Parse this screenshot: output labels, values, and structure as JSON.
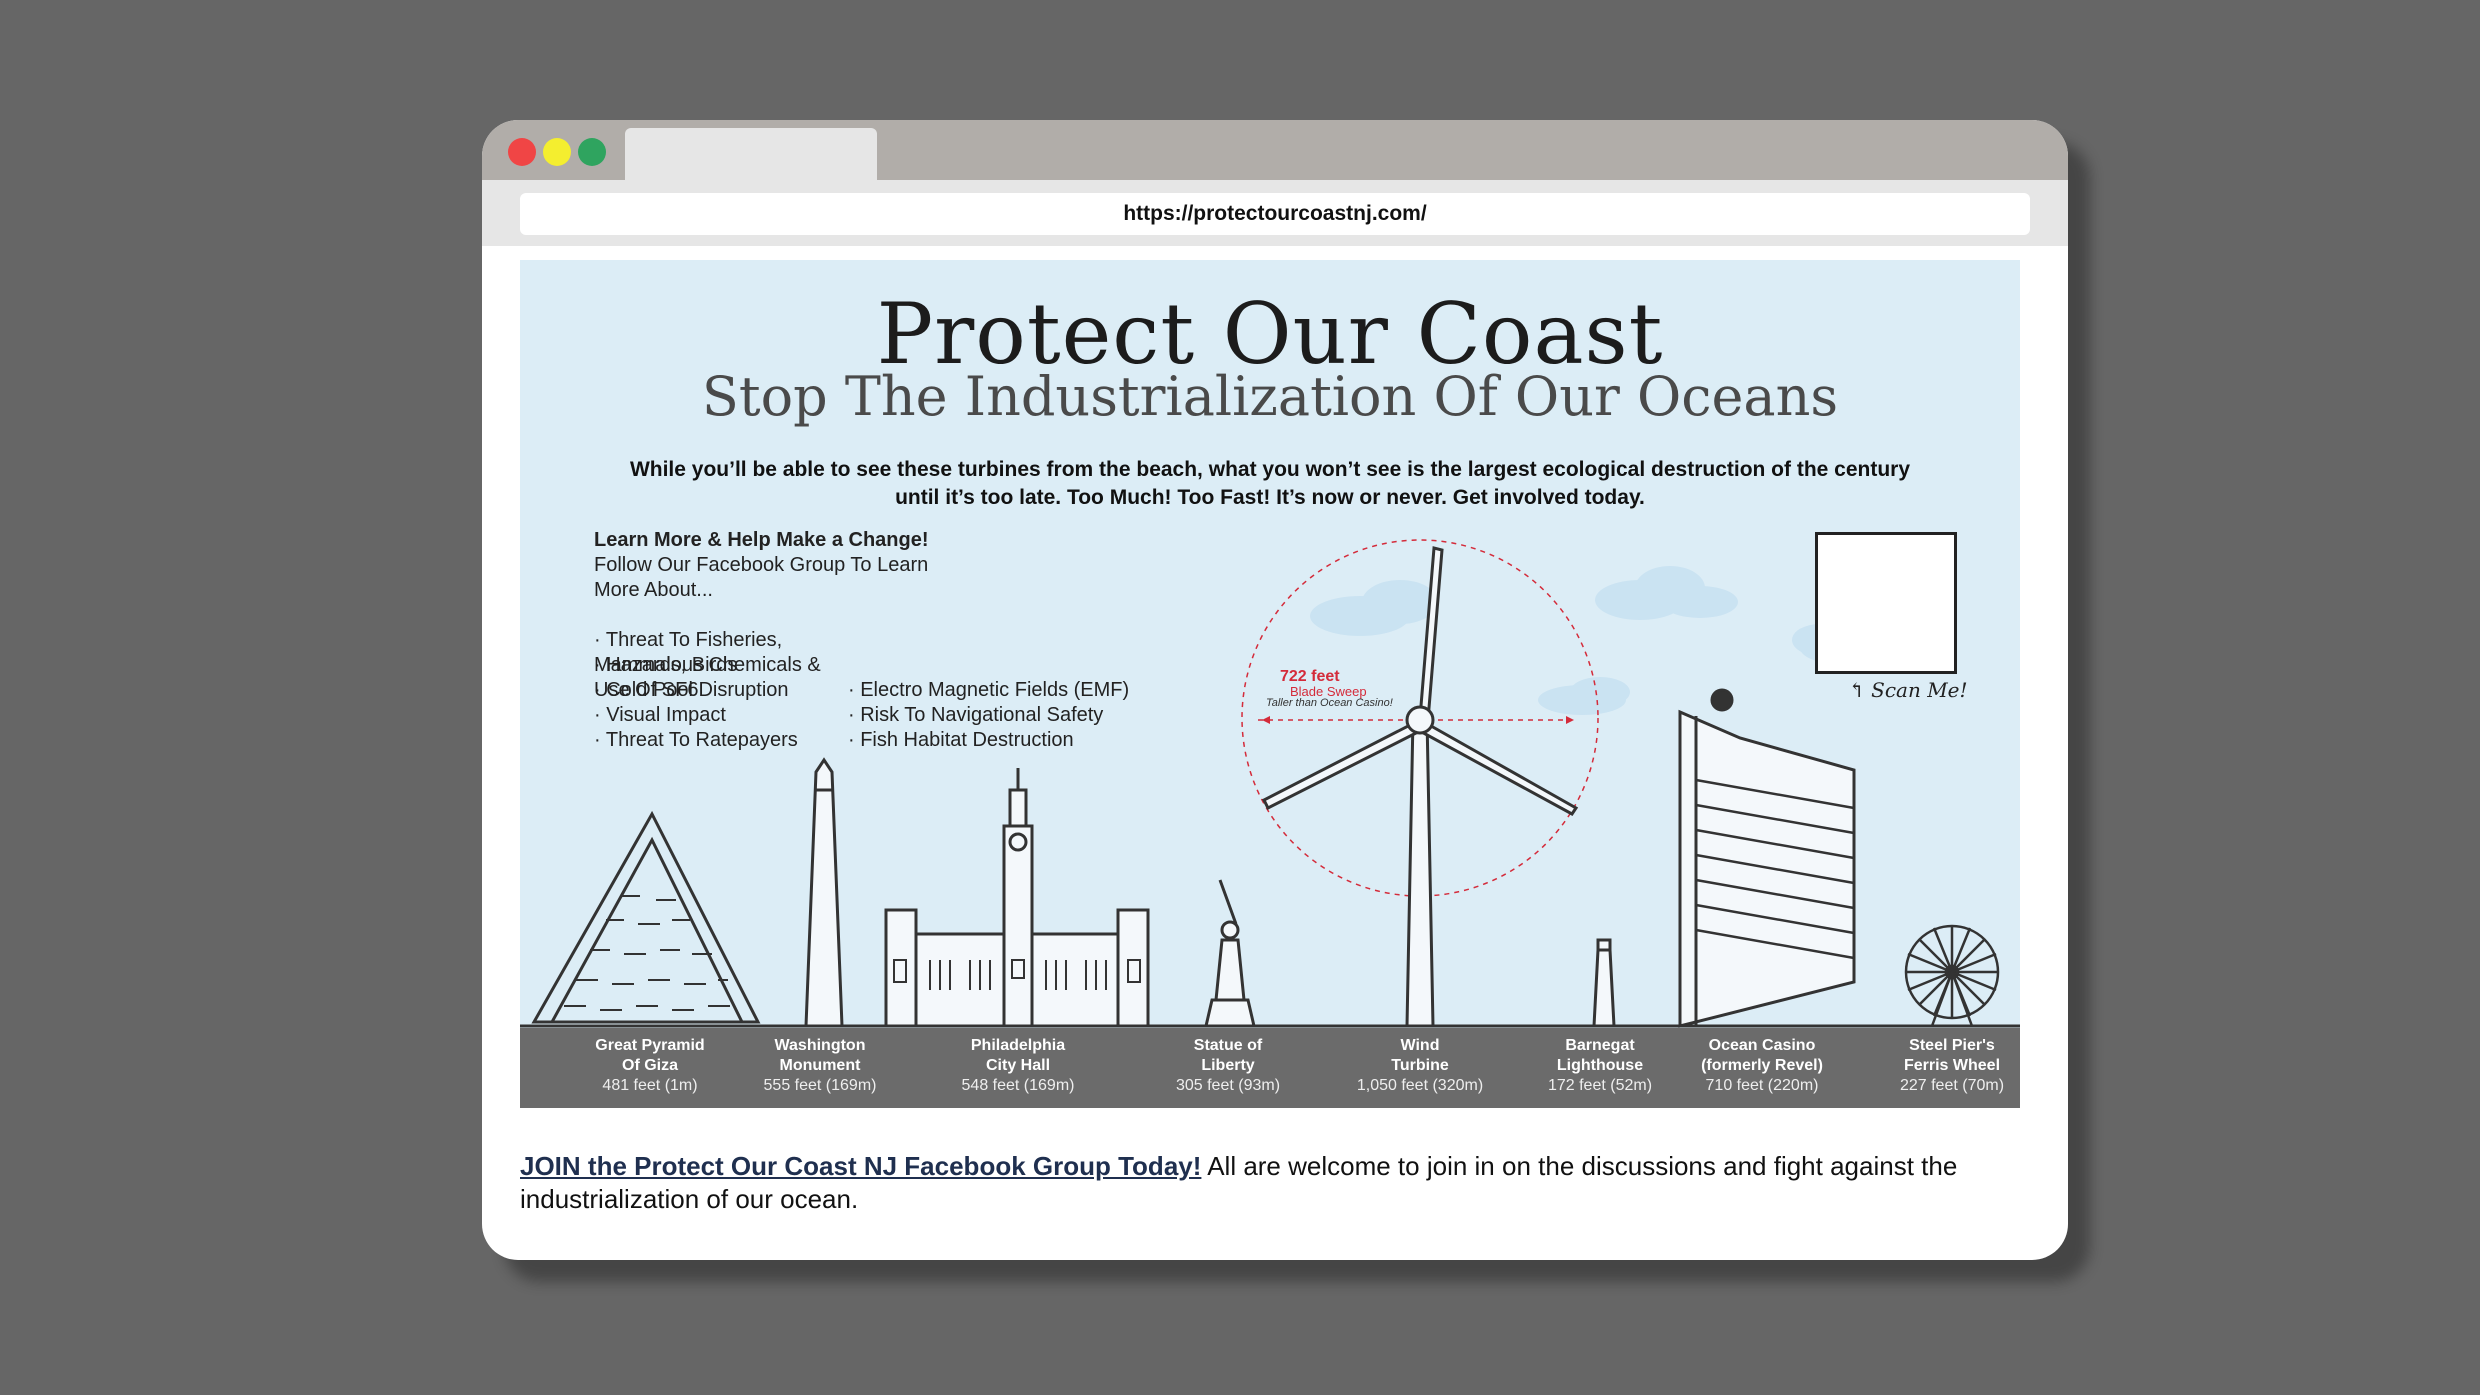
{
  "browser": {
    "url": "https://protectourcoastnj.com/",
    "controls": [
      "close-dot",
      "minimize-dot",
      "maximize-dot"
    ]
  },
  "banner": {
    "title": "Protect Our Coast",
    "subtitle": "Stop The Industrialization Of Our Oceans",
    "lead": "While you’ll be able to see these turbines from the beach, what you won’t see is the largest ecological destruction of the century until it’s too late. Too Much! Too Fast! It’s now or never. Get involved today.",
    "learn_heading": "Learn More & Help Make a Change!",
    "learn_line1": "Follow Our Facebook Group To Learn",
    "learn_line2": "More About...",
    "bullets_left": [
      "· Threat To Fisheries, Mammals, Birds",
      "· Hazardous Chemicals & Use Of SF6",
      "· Cold Pool Disruption",
      "· Visual Impact",
      "· Threat To Ratepayers"
    ],
    "bullets_right": [
      "· Electro Magnetic Fields (EMF)",
      "· Risk To Navigational Safety",
      "· Fish Habitat Destruction"
    ],
    "sweep": {
      "value": "722 feet",
      "label": "Blade Sweep",
      "note": "Taller than Ocean Casino!"
    },
    "scan_label": "Scan Me!",
    "landmarks": [
      {
        "name1": "Great Pyramid",
        "name2": "Of Giza",
        "height": "481 feet (1m)"
      },
      {
        "name1": "Washington",
        "name2": "Monument",
        "height": "555 feet (169m)"
      },
      {
        "name1": "Philadelphia",
        "name2": "City Hall",
        "height": "548 feet (169m)"
      },
      {
        "name1": "Statue of",
        "name2": "Liberty",
        "height": "305 feet (93m)"
      },
      {
        "name1": "Wind",
        "name2": "Turbine",
        "height": "1,050 feet (320m)"
      },
      {
        "name1": "Barnegat",
        "name2": "Lighthouse",
        "height": "172 feet (52m)"
      },
      {
        "name1": "Ocean Casino",
        "name2": "(formerly Revel)",
        "height": "710 feet (220m)"
      },
      {
        "name1": "Steel Pier's",
        "name2": "Ferris Wheel",
        "height": "227 feet (70m)"
      }
    ],
    "colors": {
      "sky": "#dcedf6",
      "label_bar": "#6b6b6b",
      "sweep": "#d42b3a"
    }
  },
  "cta": {
    "link_text": "JOIN the Protect Our Coast NJ Facebook Group Today!",
    "text": " All are welcome to join in on the discussions and fight against the industrialization of our ocean."
  }
}
